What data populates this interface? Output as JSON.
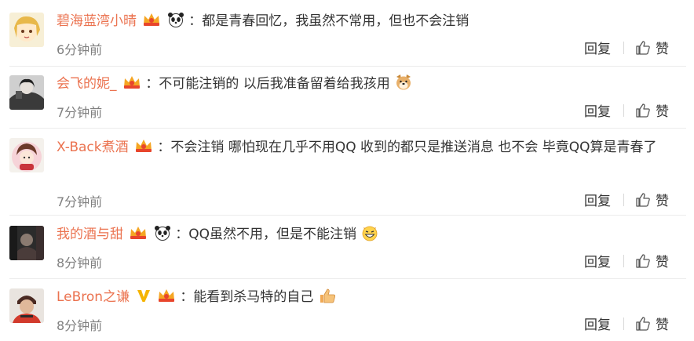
{
  "colors": {
    "username": "#eb7350",
    "time": "#808080",
    "text": "#333333"
  },
  "comments": [
    {
      "username": "碧海蓝湾小晴",
      "badges": [
        "vip-crown-badge",
        "panda-emoji"
      ],
      "text": "：都是青春回忆，我虽然不常用，但也不会注销",
      "trailing_emoji": "",
      "time": "6分钟前",
      "reply_label": "回复",
      "like_label": "赞"
    },
    {
      "username": "会飞的妮_",
      "badges": [
        "vip-crown-badge"
      ],
      "text": "：不可能注销的 以后我准备留着给我孩用",
      "trailing_emoji": "doge-emoji",
      "time": "7分钟前",
      "reply_label": "回复",
      "like_label": "赞"
    },
    {
      "username": "X-Back煮酒",
      "badges": [
        "vip-crown-badge"
      ],
      "text": "：不会注销 哪怕现在几乎不用QQ 收到的都只是推送消息 也不会 毕竟QQ算是青春了",
      "trailing_emoji": "",
      "time": "7分钟前",
      "reply_label": "回复",
      "like_label": "赞"
    },
    {
      "username": "我的酒与甜",
      "badges": [
        "vip-crown-badge",
        "panda-emoji"
      ],
      "text": "：QQ虽然不用，但是不能注销",
      "trailing_emoji": "grin-emoji",
      "time": "8分钟前",
      "reply_label": "回复",
      "like_label": "赞"
    },
    {
      "username": "LeBron之谦",
      "badges": [
        "verified-v-badge",
        "vip-crown-badge"
      ],
      "text": "：能看到杀马特的自己",
      "trailing_emoji": "thumbs-up-emoji",
      "time": "8分钟前",
      "reply_label": "回复",
      "like_label": "赞"
    }
  ]
}
